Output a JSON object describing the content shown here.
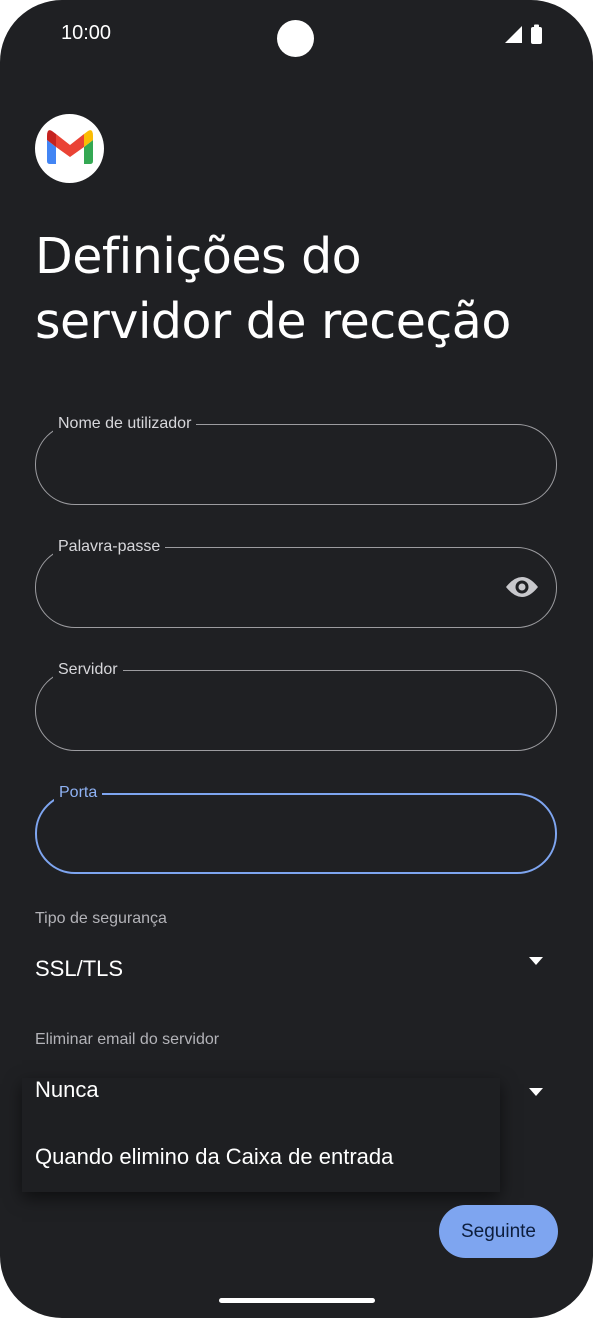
{
  "status_bar": {
    "time": "10:00"
  },
  "title_lines": [
    "Definições do",
    "servidor de receção"
  ],
  "fields": {
    "username": {
      "label": "Nome de utilizador",
      "value": ""
    },
    "password": {
      "label": "Palavra-passe",
      "value": ""
    },
    "server": {
      "label": "Servidor",
      "value": ""
    },
    "port": {
      "label": "Porta",
      "value": ""
    }
  },
  "security": {
    "label": "Tipo de segurança",
    "value": "SSL/TLS"
  },
  "delete_email": {
    "label": "Eliminar email do servidor",
    "value": "Nunca",
    "options": [
      "Quando elimino da Caixa de entrada"
    ]
  },
  "next_button": {
    "label": "Seguinte"
  },
  "colors": {
    "background": "#1f2023",
    "accent": "#7ea5f0"
  },
  "icons": [
    "gmail-logo",
    "signal-icon",
    "battery-icon",
    "eye-icon",
    "dropdown-arrow-icon"
  ]
}
